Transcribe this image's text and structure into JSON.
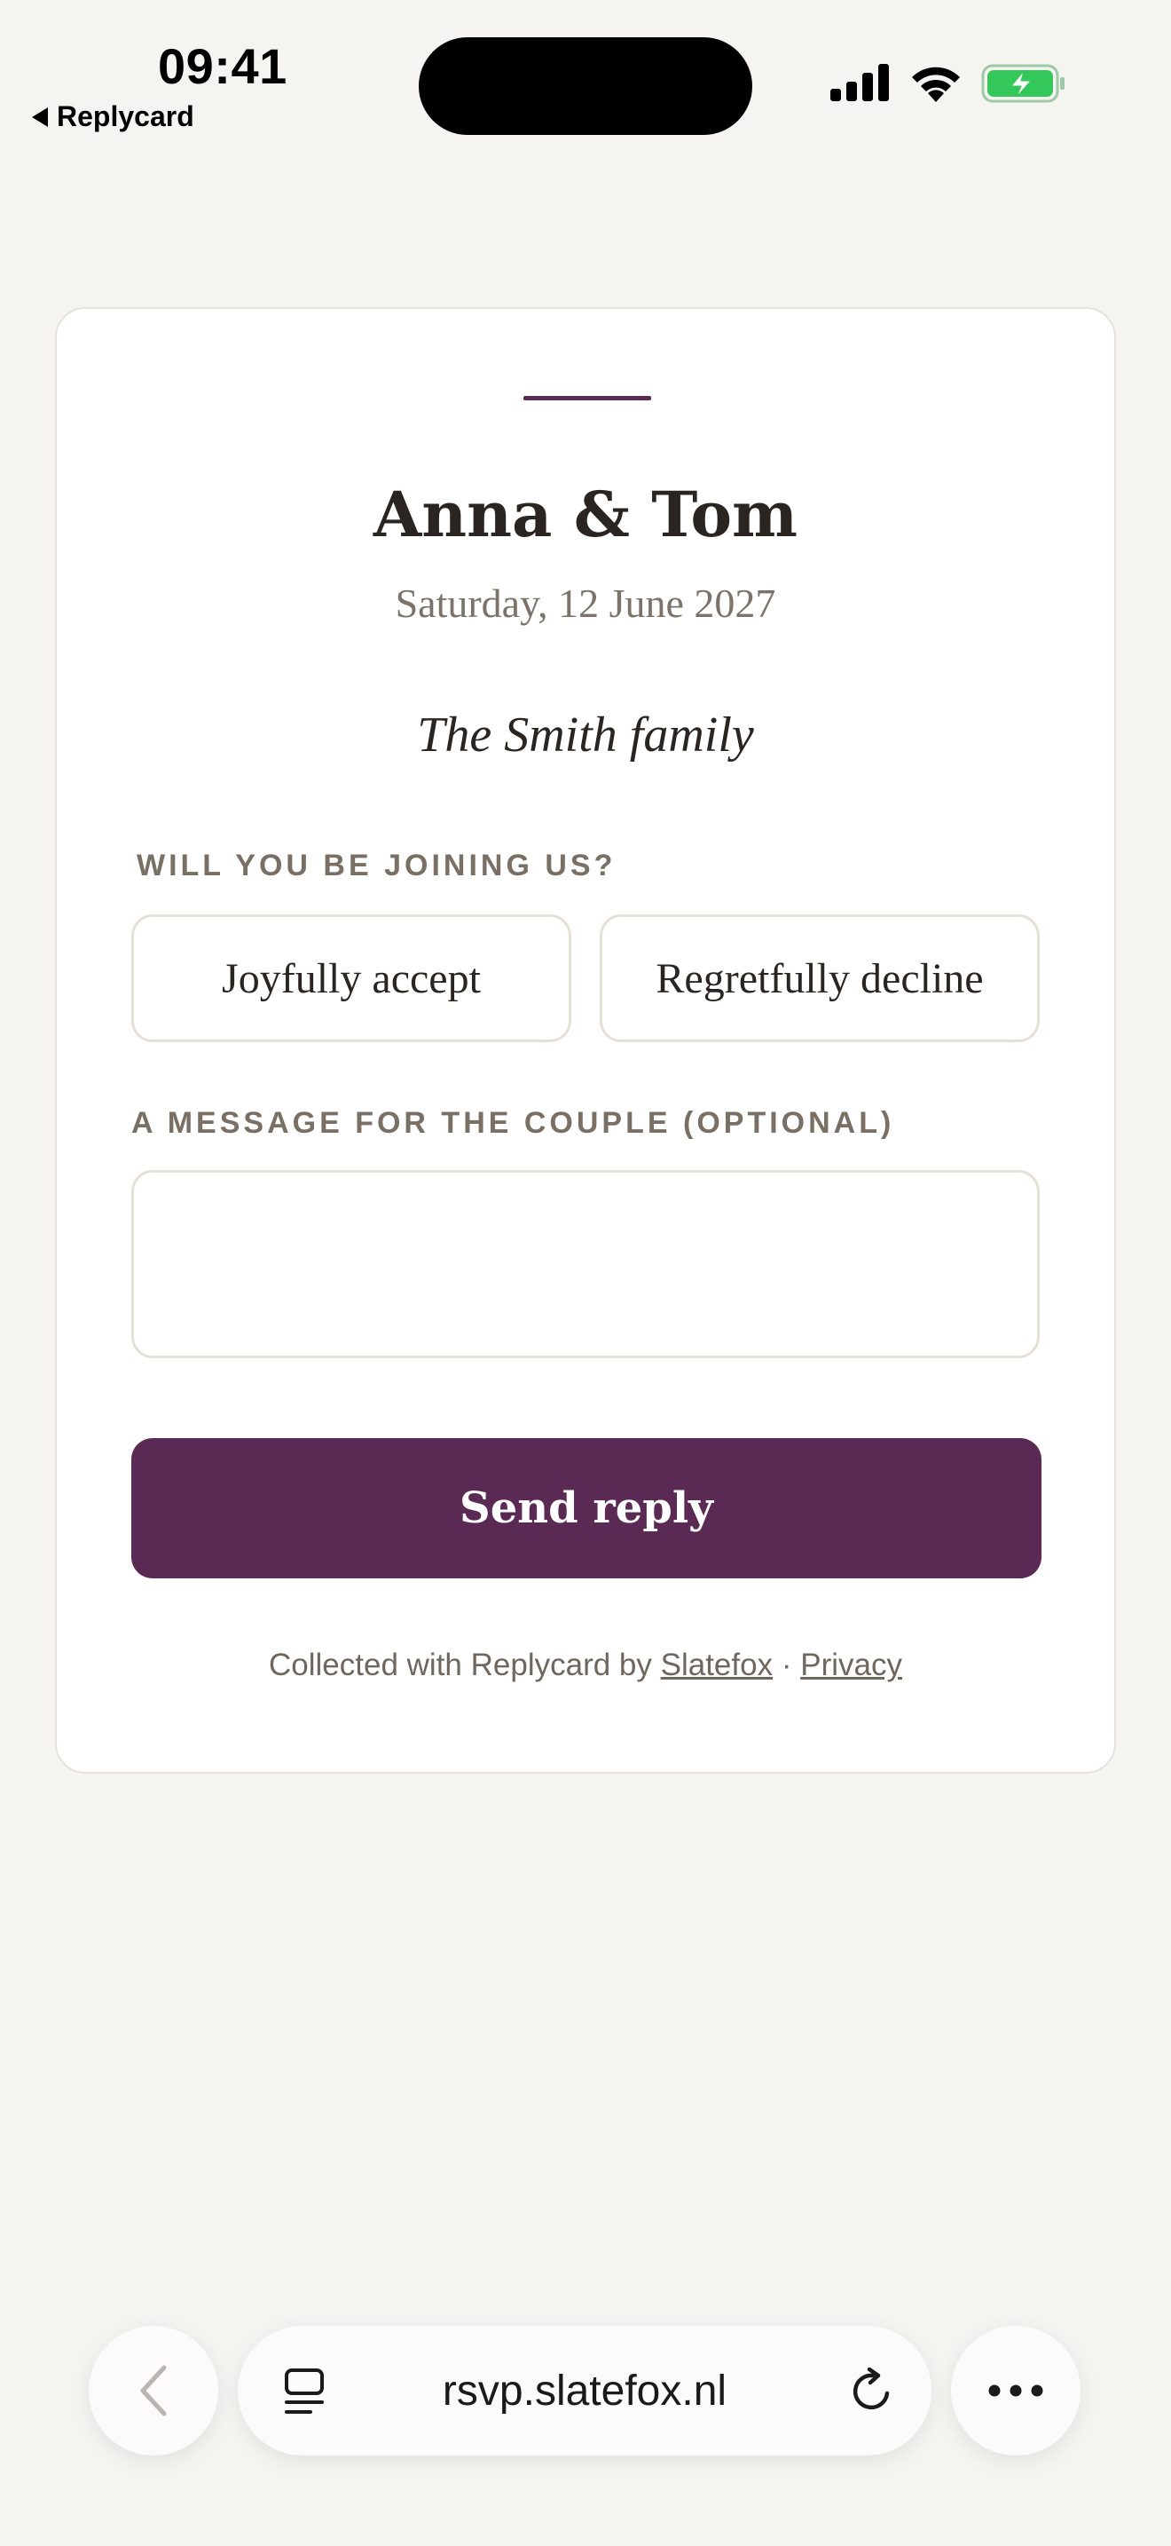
{
  "status_bar": {
    "time": "09:41",
    "back_app": "Replycard"
  },
  "card": {
    "couple": "Anna & Tom",
    "date": "Saturday, 12 June 2027",
    "guest": "The Smith family",
    "join_label": "WILL YOU BE JOINING US?",
    "accept_label": "Joyfully accept",
    "decline_label": "Regretfully decline",
    "message_label": "A MESSAGE FOR THE COUPLE (OPTIONAL)",
    "message_value": "",
    "send_label": "Send reply",
    "footer": {
      "prefix": "Collected with Replycard by",
      "brand_link": "Slatefox",
      "separator": "·",
      "privacy_link": "Privacy"
    }
  },
  "browser": {
    "url": "rsvp.slatefox.nl"
  },
  "colors": {
    "accent": "#5a2a55",
    "background": "#f5f4f1",
    "battery": "#34c759"
  },
  "icons": [
    "signal-icon",
    "wifi-icon",
    "battery-charging-icon",
    "chevron-left-icon",
    "tabs-icon",
    "reload-icon",
    "more-icon"
  ]
}
